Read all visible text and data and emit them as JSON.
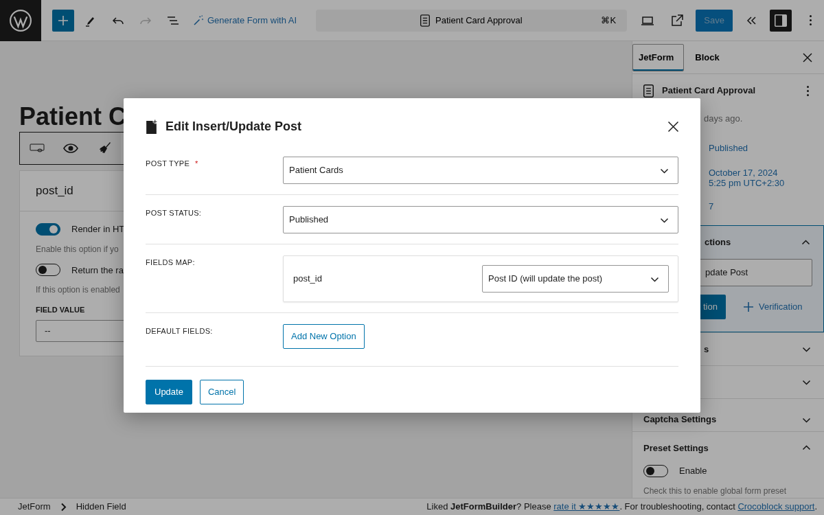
{
  "toolbar": {
    "ai_button": "Generate Form with AI",
    "command_bar": {
      "title": "Patient Card Approval",
      "shortcut": "⌘K"
    },
    "save_button": {
      "label": "Save",
      "disabled": true
    }
  },
  "canvas": {
    "title": "Patient C",
    "field_card": {
      "name": "post_id",
      "toggles": [
        {
          "label": "Render in HT",
          "on": true,
          "help": "Enable this option if yo"
        },
        {
          "label": "Return the ra",
          "on": false,
          "help": "If this option is enabled"
        }
      ],
      "value_label": "FIELD VALUE",
      "value": "--"
    }
  },
  "sidebar": {
    "tabs": [
      {
        "label": "JetForm",
        "selected": true
      },
      {
        "label": "Block",
        "selected": false
      }
    ],
    "form_title": "Patient Card Approval",
    "modified": "days ago.",
    "status": "Published",
    "date_lines": [
      "October 17, 2024",
      "5:25 pm UTC+2:30"
    ],
    "revisions": "7",
    "panels": [
      {
        "kind": "actions",
        "title": "ctions",
        "expanded": true,
        "action_item": "pdate Post",
        "add_button": "tion",
        "verification_button": "Verification"
      },
      {
        "kind": "plain",
        "title": "s",
        "expanded": false
      },
      {
        "kind": "plain",
        "expanded": false
      },
      {
        "kind": "plain",
        "title": "Captcha Settings",
        "expanded": false
      },
      {
        "kind": "toggle",
        "title": "Preset Settings",
        "expanded": true,
        "toggle": {
          "label": "Enable",
          "on": false
        },
        "help": "Check this to enable global form preset"
      }
    ]
  },
  "modal": {
    "title": "Edit Insert/Update Post",
    "rows": [
      {
        "kind": "select",
        "label": "POST TYPE",
        "required_mark": "*",
        "value": "Patient Cards"
      },
      {
        "kind": "select",
        "label": "POST STATUS:",
        "value": "Published"
      },
      {
        "kind": "map",
        "label": "FIELDS MAP:",
        "items": [
          {
            "field": "post_id",
            "value": "Post ID (will update the post)"
          }
        ]
      },
      {
        "kind": "button",
        "label": "DEFAULT FIELDS:",
        "button": "Add New Option"
      }
    ],
    "buttons": [
      {
        "label": "Update",
        "primary": true
      },
      {
        "label": "Cancel",
        "primary": false
      }
    ]
  },
  "footer": {
    "breadcrumbs": [
      "JetForm",
      "Hidden Field"
    ],
    "notice": {
      "before": "Liked **JetFormBuilder**? Please ",
      "rate_link": "rate it ★★★★★",
      "middle": ". For troubleshooting, contact ",
      "support_link": "Crocoblock support",
      "after": "."
    }
  }
}
